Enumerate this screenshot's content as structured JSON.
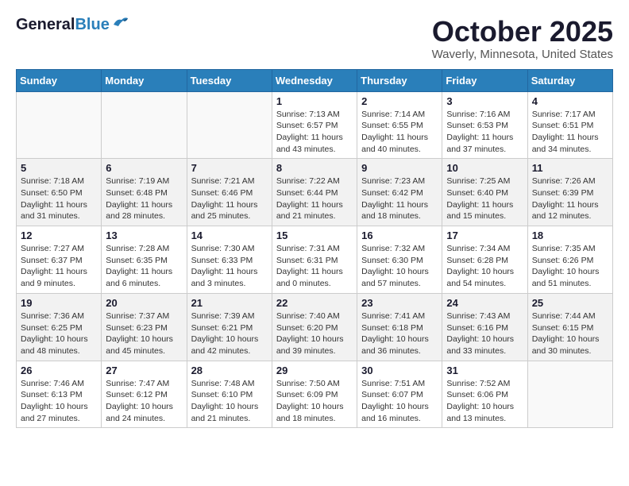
{
  "header": {
    "logo_general": "General",
    "logo_blue": "Blue",
    "month_title": "October 2025",
    "location": "Waverly, Minnesota, United States"
  },
  "days_of_week": [
    "Sunday",
    "Monday",
    "Tuesday",
    "Wednesday",
    "Thursday",
    "Friday",
    "Saturday"
  ],
  "weeks": [
    {
      "days": [
        {
          "number": "",
          "info": ""
        },
        {
          "number": "",
          "info": ""
        },
        {
          "number": "",
          "info": ""
        },
        {
          "number": "1",
          "info": "Sunrise: 7:13 AM\nSunset: 6:57 PM\nDaylight: 11 hours\nand 43 minutes."
        },
        {
          "number": "2",
          "info": "Sunrise: 7:14 AM\nSunset: 6:55 PM\nDaylight: 11 hours\nand 40 minutes."
        },
        {
          "number": "3",
          "info": "Sunrise: 7:16 AM\nSunset: 6:53 PM\nDaylight: 11 hours\nand 37 minutes."
        },
        {
          "number": "4",
          "info": "Sunrise: 7:17 AM\nSunset: 6:51 PM\nDaylight: 11 hours\nand 34 minutes."
        }
      ]
    },
    {
      "days": [
        {
          "number": "5",
          "info": "Sunrise: 7:18 AM\nSunset: 6:50 PM\nDaylight: 11 hours\nand 31 minutes."
        },
        {
          "number": "6",
          "info": "Sunrise: 7:19 AM\nSunset: 6:48 PM\nDaylight: 11 hours\nand 28 minutes."
        },
        {
          "number": "7",
          "info": "Sunrise: 7:21 AM\nSunset: 6:46 PM\nDaylight: 11 hours\nand 25 minutes."
        },
        {
          "number": "8",
          "info": "Sunrise: 7:22 AM\nSunset: 6:44 PM\nDaylight: 11 hours\nand 21 minutes."
        },
        {
          "number": "9",
          "info": "Sunrise: 7:23 AM\nSunset: 6:42 PM\nDaylight: 11 hours\nand 18 minutes."
        },
        {
          "number": "10",
          "info": "Sunrise: 7:25 AM\nSunset: 6:40 PM\nDaylight: 11 hours\nand 15 minutes."
        },
        {
          "number": "11",
          "info": "Sunrise: 7:26 AM\nSunset: 6:39 PM\nDaylight: 11 hours\nand 12 minutes."
        }
      ]
    },
    {
      "days": [
        {
          "number": "12",
          "info": "Sunrise: 7:27 AM\nSunset: 6:37 PM\nDaylight: 11 hours\nand 9 minutes."
        },
        {
          "number": "13",
          "info": "Sunrise: 7:28 AM\nSunset: 6:35 PM\nDaylight: 11 hours\nand 6 minutes."
        },
        {
          "number": "14",
          "info": "Sunrise: 7:30 AM\nSunset: 6:33 PM\nDaylight: 11 hours\nand 3 minutes."
        },
        {
          "number": "15",
          "info": "Sunrise: 7:31 AM\nSunset: 6:31 PM\nDaylight: 11 hours\nand 0 minutes."
        },
        {
          "number": "16",
          "info": "Sunrise: 7:32 AM\nSunset: 6:30 PM\nDaylight: 10 hours\nand 57 minutes."
        },
        {
          "number": "17",
          "info": "Sunrise: 7:34 AM\nSunset: 6:28 PM\nDaylight: 10 hours\nand 54 minutes."
        },
        {
          "number": "18",
          "info": "Sunrise: 7:35 AM\nSunset: 6:26 PM\nDaylight: 10 hours\nand 51 minutes."
        }
      ]
    },
    {
      "days": [
        {
          "number": "19",
          "info": "Sunrise: 7:36 AM\nSunset: 6:25 PM\nDaylight: 10 hours\nand 48 minutes."
        },
        {
          "number": "20",
          "info": "Sunrise: 7:37 AM\nSunset: 6:23 PM\nDaylight: 10 hours\nand 45 minutes."
        },
        {
          "number": "21",
          "info": "Sunrise: 7:39 AM\nSunset: 6:21 PM\nDaylight: 10 hours\nand 42 minutes."
        },
        {
          "number": "22",
          "info": "Sunrise: 7:40 AM\nSunset: 6:20 PM\nDaylight: 10 hours\nand 39 minutes."
        },
        {
          "number": "23",
          "info": "Sunrise: 7:41 AM\nSunset: 6:18 PM\nDaylight: 10 hours\nand 36 minutes."
        },
        {
          "number": "24",
          "info": "Sunrise: 7:43 AM\nSunset: 6:16 PM\nDaylight: 10 hours\nand 33 minutes."
        },
        {
          "number": "25",
          "info": "Sunrise: 7:44 AM\nSunset: 6:15 PM\nDaylight: 10 hours\nand 30 minutes."
        }
      ]
    },
    {
      "days": [
        {
          "number": "26",
          "info": "Sunrise: 7:46 AM\nSunset: 6:13 PM\nDaylight: 10 hours\nand 27 minutes."
        },
        {
          "number": "27",
          "info": "Sunrise: 7:47 AM\nSunset: 6:12 PM\nDaylight: 10 hours\nand 24 minutes."
        },
        {
          "number": "28",
          "info": "Sunrise: 7:48 AM\nSunset: 6:10 PM\nDaylight: 10 hours\nand 21 minutes."
        },
        {
          "number": "29",
          "info": "Sunrise: 7:50 AM\nSunset: 6:09 PM\nDaylight: 10 hours\nand 18 minutes."
        },
        {
          "number": "30",
          "info": "Sunrise: 7:51 AM\nSunset: 6:07 PM\nDaylight: 10 hours\nand 16 minutes."
        },
        {
          "number": "31",
          "info": "Sunrise: 7:52 AM\nSunset: 6:06 PM\nDaylight: 10 hours\nand 13 minutes."
        },
        {
          "number": "",
          "info": ""
        }
      ]
    }
  ]
}
